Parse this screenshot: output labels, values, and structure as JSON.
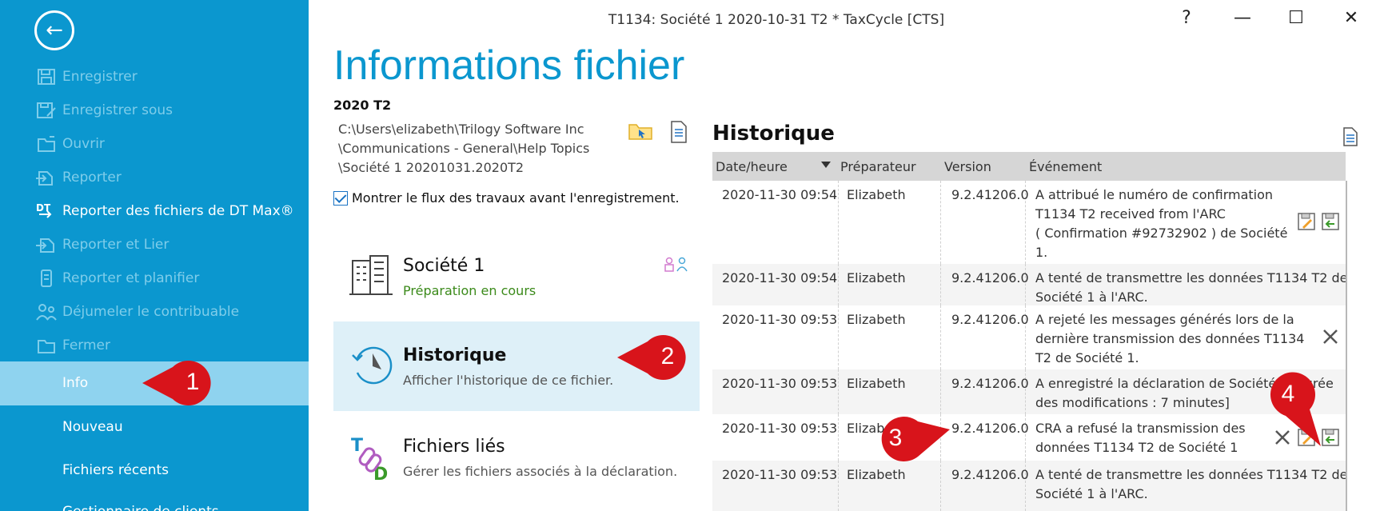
{
  "window": {
    "title": "T1134: Société 1 2020-10-31 T2 * TaxCycle [CTS]",
    "help": "?",
    "minimize": "—",
    "maximize": "☐",
    "close": "✕"
  },
  "sidebar": {
    "back_icon": "←",
    "disabled_items": [
      {
        "label": "Enregistrer",
        "icon": "save-icon"
      },
      {
        "label": "Enregistrer sous",
        "icon": "save-as-icon"
      },
      {
        "label": "Ouvrir",
        "icon": "open-folder-icon"
      },
      {
        "label": "Reporter",
        "icon": "carry-forward-icon"
      }
    ],
    "dtmax": {
      "label": "Reporter des fichiers de DT Max®",
      "icon": "dt-max-icon"
    },
    "disabled_items2": [
      {
        "label": "Reporter et Lier",
        "icon": "carry-link-icon"
      },
      {
        "label": "Reporter et planifier",
        "icon": "carry-plan-icon"
      },
      {
        "label": "Déjumeler le contribuable",
        "icon": "unlink-taxpayer-icon"
      },
      {
        "label": "Fermer",
        "icon": "close-folder-icon"
      }
    ],
    "info": "Info",
    "nouveau": "Nouveau",
    "recents": "Fichiers récents",
    "clients_partial": "Gestionnaire de clients"
  },
  "main": {
    "title": "Informations fichier",
    "file_type": "2020 T2",
    "path": [
      "C:\\Users\\elizabeth\\Trilogy Software Inc",
      "\\Communications - General\\Help Topics",
      "\\Société 1 20201031.2020T2"
    ],
    "checkbox_label": "Montrer le flux des travaux avant l'enregistrement.",
    "cards": {
      "company": {
        "title": "Société 1",
        "subtitle": "Préparation en cours"
      },
      "history": {
        "title": "Historique",
        "subtitle": "Afficher l'historique de ce fichier."
      },
      "linked": {
        "title": "Fichiers liés",
        "subtitle": "Gérer les fichiers associés à la déclaration."
      }
    }
  },
  "history": {
    "title": "Historique",
    "columns": [
      "Date/heure",
      "Préparateur",
      "Version",
      "Événement"
    ],
    "rows": [
      {
        "date": "2020-11-30 09:54",
        "preparer": "Elizabeth",
        "version": "9.2.41206.0",
        "event": [
          "A attribué le numéro de confirmation",
          "T1134 T2 received from l'ARC",
          "( Confirmation #92732902 ) de Société",
          "1."
        ]
      },
      {
        "date": "2020-11-30 09:54",
        "preparer": "Elizabeth",
        "version": "9.2.41206.0",
        "event": [
          "A tenté de transmettre les données T1134 T2 de",
          "Société 1 à l'ARC."
        ]
      },
      {
        "date": "2020-11-30 09:53",
        "preparer": "Elizabeth",
        "version": "9.2.41206.0",
        "event": [
          "A rejeté les messages générés lors de la",
          "dernière transmission des données T1134",
          "T2 de Société 1."
        ]
      },
      {
        "date": "2020-11-30 09:53",
        "preparer": "Elizabeth",
        "version": "9.2.41206.0",
        "event": [
          "A enregistré la déclaration de Société 1, durée",
          "des modifications : 7 minutes]"
        ]
      },
      {
        "date": "2020-11-30 09:53",
        "preparer": "Elizabeth",
        "version": "9.2.41206.0",
        "event": [
          "CRA a refusé la transmission des",
          "données T1134 T2 de Société 1"
        ]
      },
      {
        "date": "2020-11-30 09:53",
        "preparer": "Elizabeth",
        "version": "9.2.41206.0",
        "event": [
          "A tenté de transmettre les données T1134 T2 de",
          "Société 1 à l'ARC."
        ]
      }
    ]
  },
  "callouts": [
    "1",
    "2",
    "3",
    "4"
  ],
  "colors": {
    "sidebar": "#0b97cf",
    "selected": "#8fd3ef",
    "title": "#0b97cf",
    "callout": "#d8141b"
  }
}
